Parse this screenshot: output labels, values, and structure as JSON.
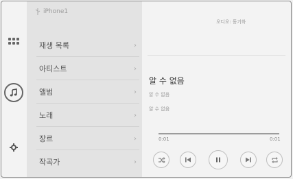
{
  "source": {
    "label": "iPhone1"
  },
  "menu": {
    "items": [
      {
        "label": "재생 목록"
      },
      {
        "label": "아티스트"
      },
      {
        "label": "앨범"
      },
      {
        "label": "노래"
      },
      {
        "label": "장르"
      },
      {
        "label": "작곡가"
      }
    ]
  },
  "player": {
    "audio_mode": "오디오: 동기화",
    "track_title": "알 수 없음",
    "artist": "알 수 없음",
    "album": "알 수 없음",
    "elapsed": "0:01",
    "duration": "0:01",
    "progress": 1.0
  },
  "icons": {
    "rail": [
      "apps-grid-icon",
      "music-note-icon",
      "settings-icon"
    ],
    "controls": [
      "shuffle-icon",
      "previous-track-icon",
      "pause-icon",
      "next-track-icon",
      "repeat-icon"
    ]
  }
}
